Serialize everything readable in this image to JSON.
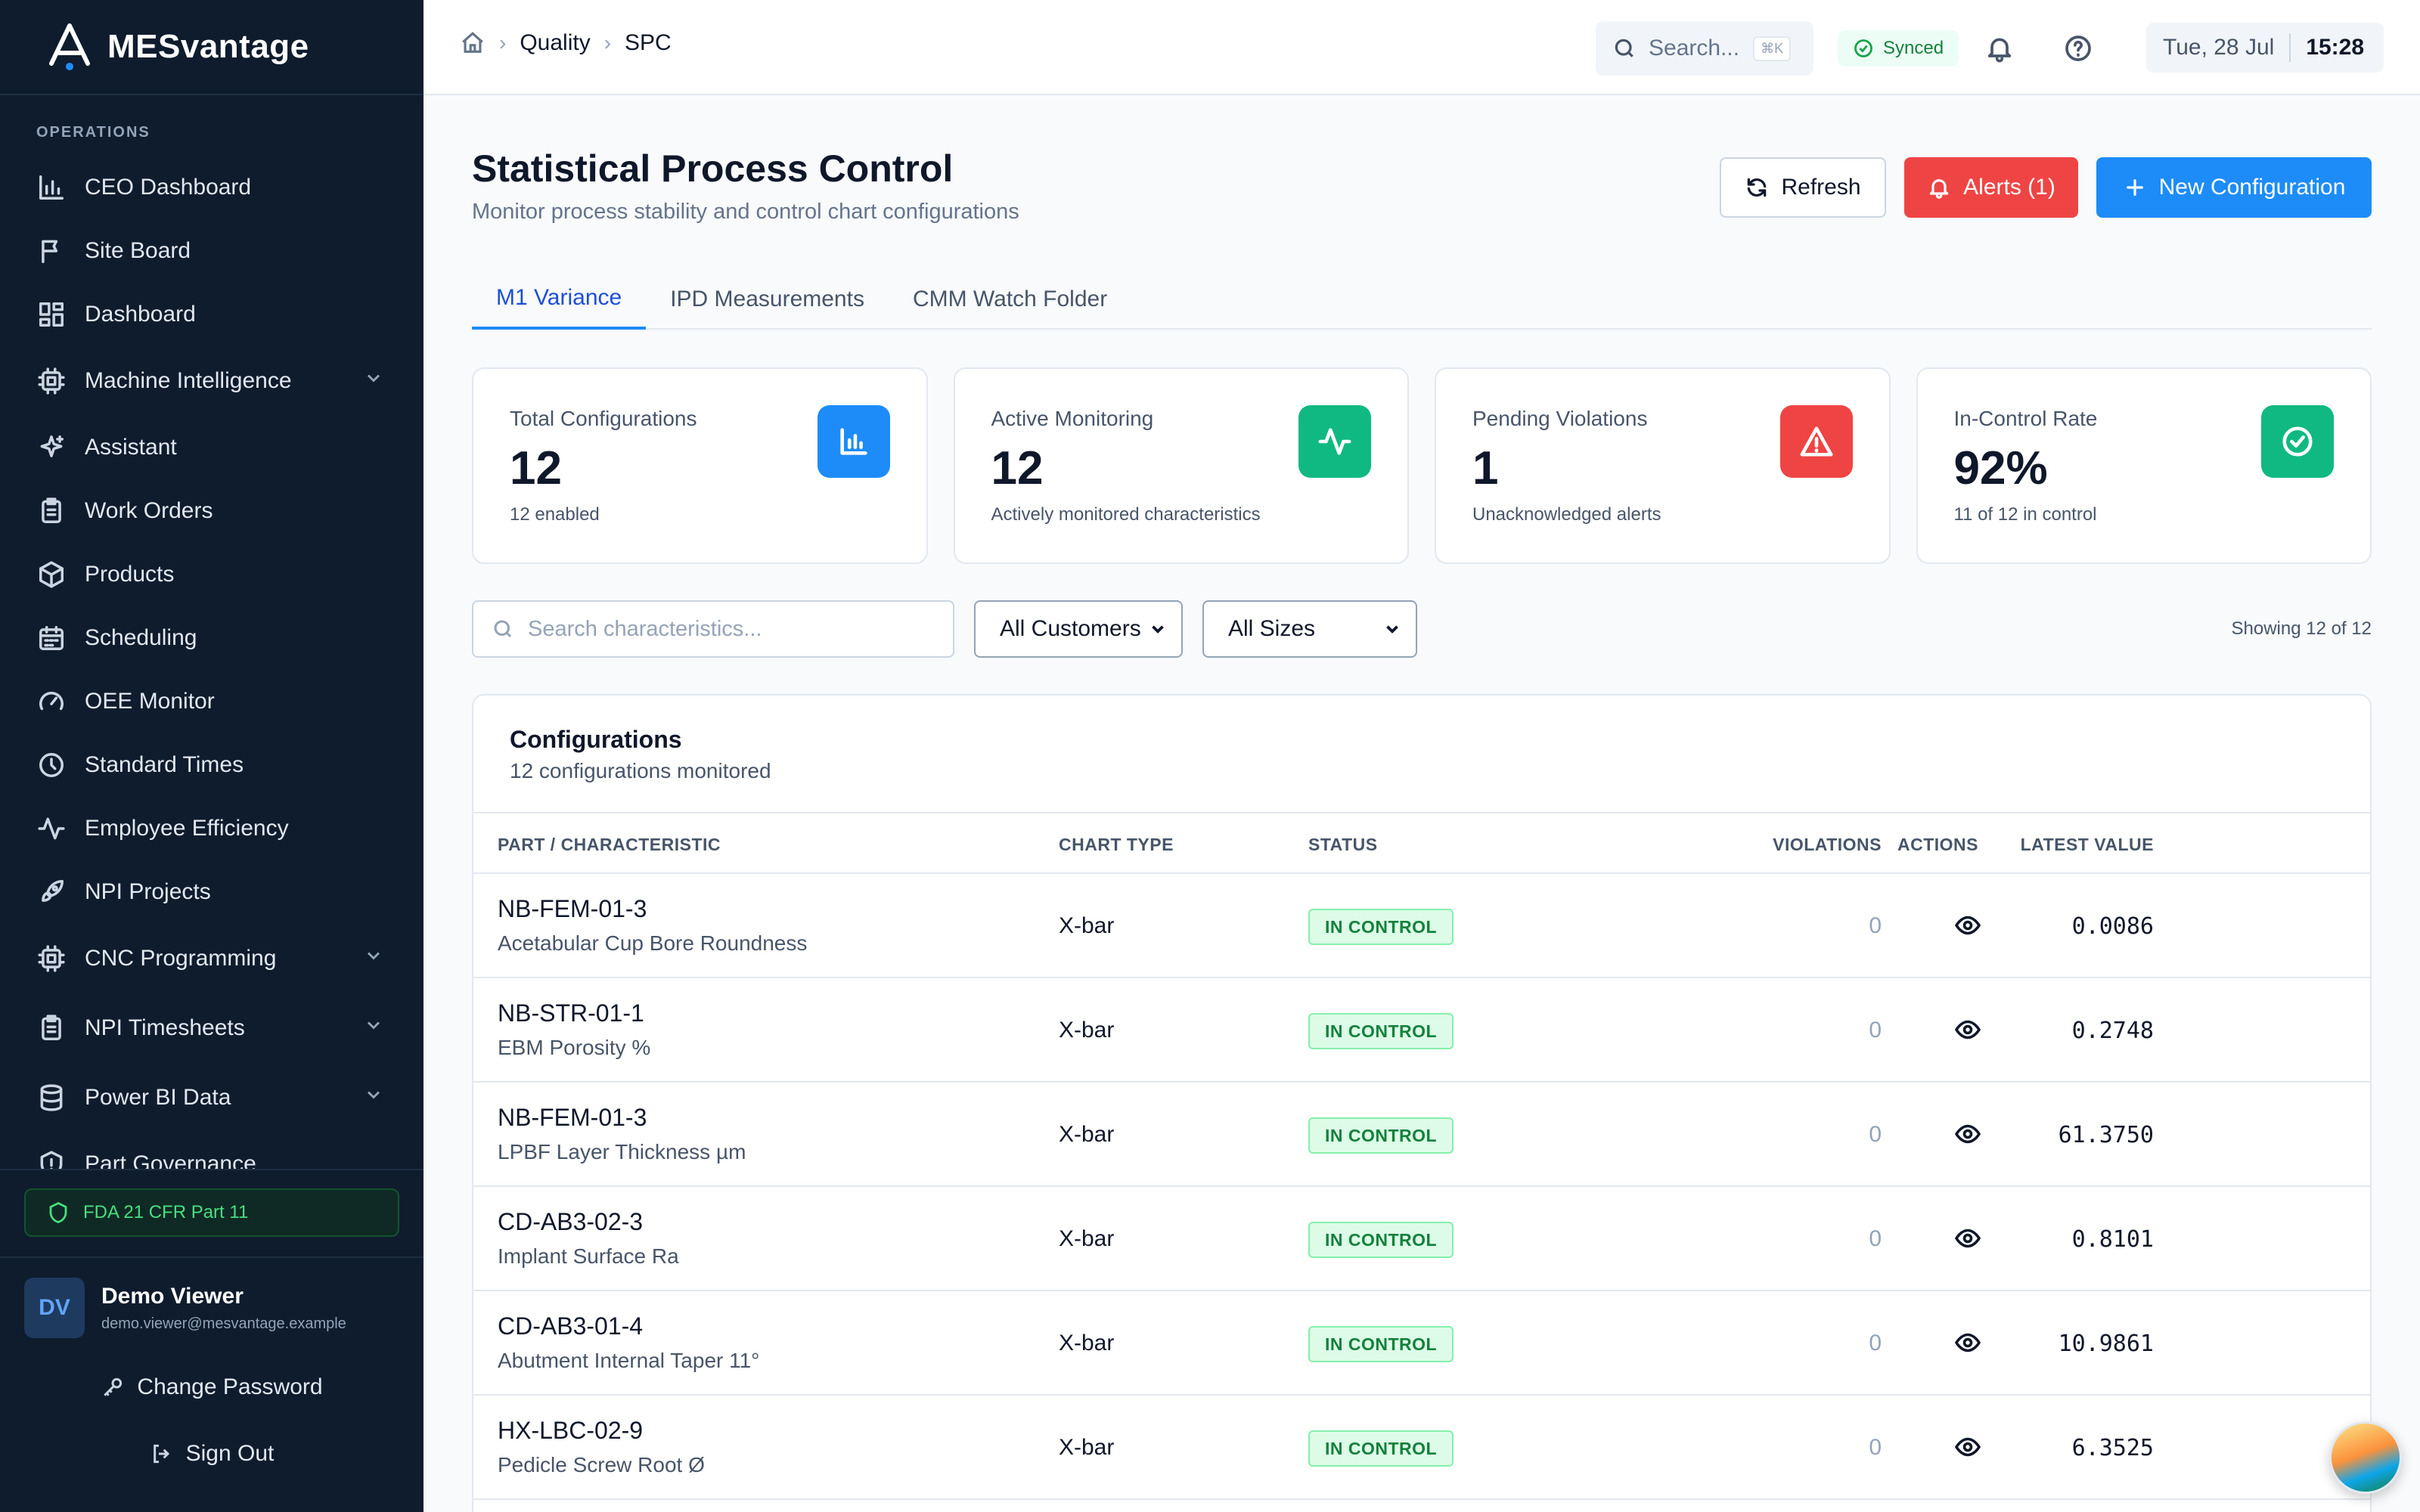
{
  "brand": {
    "name": "MESvantage"
  },
  "sidebar": {
    "section": "OPERATIONS",
    "items": [
      {
        "label": "CEO Dashboard",
        "icon": "bar-chart-icon",
        "chevron": false
      },
      {
        "label": "Site Board",
        "icon": "flag-icon",
        "chevron": false
      },
      {
        "label": "Dashboard",
        "icon": "grid-icon",
        "chevron": false
      },
      {
        "label": "Machine Intelligence",
        "icon": "cpu-icon",
        "chevron": true
      },
      {
        "label": "Assistant",
        "icon": "sparkles-icon",
        "chevron": false
      },
      {
        "label": "Work Orders",
        "icon": "clipboard-icon",
        "chevron": false
      },
      {
        "label": "Products",
        "icon": "package-icon",
        "chevron": false
      },
      {
        "label": "Scheduling",
        "icon": "calendar-icon",
        "chevron": false
      },
      {
        "label": "OEE Monitor",
        "icon": "gauge-icon",
        "chevron": false
      },
      {
        "label": "Standard Times",
        "icon": "clock-icon",
        "chevron": false
      },
      {
        "label": "Employee Efficiency",
        "icon": "activity-icon",
        "chevron": false
      },
      {
        "label": "NPI Projects",
        "icon": "rocket-icon",
        "chevron": false
      },
      {
        "label": "CNC Programming",
        "icon": "cpu-icon",
        "chevron": true
      },
      {
        "label": "NPI Timesheets",
        "icon": "clipboard-icon",
        "chevron": true
      },
      {
        "label": "Power BI Data",
        "icon": "database-icon",
        "chevron": true
      },
      {
        "label": "Part Governance",
        "icon": "shield-alert-icon",
        "chevron": false
      }
    ],
    "compliance": "FDA 21 CFR Part 11",
    "user": {
      "initials": "DV",
      "name": "Demo Viewer",
      "email": "demo.viewer@mesvantage.example"
    },
    "change_password": "Change Password",
    "sign_out": "Sign Out"
  },
  "topbar": {
    "breadcrumb": [
      "Quality",
      "SPC"
    ],
    "search_placeholder": "Search...",
    "search_shortcut": "⌘K",
    "sync_status": "Synced",
    "date": "Tue, 28 Jul",
    "time": "15:28"
  },
  "page": {
    "title": "Statistical Process Control",
    "subtitle": "Monitor process stability and control chart configurations",
    "buttons": {
      "refresh": "Refresh",
      "alerts": "Alerts (1)",
      "new": "New Configuration"
    },
    "tabs": [
      "M1 Variance",
      "IPD Measurements",
      "CMM Watch Folder"
    ],
    "active_tab": 0
  },
  "stats": [
    {
      "label": "Total Configurations",
      "value": "12",
      "sub": "12 enabled",
      "icon": "bar-chart-icon",
      "color": "#1d8cf8"
    },
    {
      "label": "Active Monitoring",
      "value": "12",
      "sub": "Actively monitored characteristics",
      "icon": "activity-icon",
      "color": "#10b981"
    },
    {
      "label": "Pending Violations",
      "value": "1",
      "sub": "Unacknowledged alerts",
      "icon": "alert-triangle-icon",
      "color": "#ef4444"
    },
    {
      "label": "In-Control Rate",
      "value": "92%",
      "sub": "11 of 12 in control",
      "icon": "check-circle-icon",
      "color": "#10b981"
    }
  ],
  "filters": {
    "search_placeholder": "Search characteristics...",
    "customer": "All Customers",
    "size": "All Sizes",
    "showing": "Showing 12 of 12"
  },
  "table": {
    "title": "Configurations",
    "subtitle": "12 configurations monitored",
    "columns": [
      "PART / CHARACTERISTIC",
      "CHART TYPE",
      "STATUS",
      "VIOLATIONS",
      "LATEST VALUE",
      "ACTIONS"
    ],
    "rows": [
      {
        "part": "NB-FEM-01-3",
        "characteristic": "Acetabular Cup Bore Roundness",
        "chart_type": "X-bar",
        "status": "IN CONTROL",
        "violations": "0",
        "latest": "0.0086"
      },
      {
        "part": "NB-STR-01-1",
        "characteristic": "EBM Porosity %",
        "chart_type": "X-bar",
        "status": "IN CONTROL",
        "violations": "0",
        "latest": "0.2748"
      },
      {
        "part": "NB-FEM-01-3",
        "characteristic": "LPBF Layer Thickness µm",
        "chart_type": "X-bar",
        "status": "IN CONTROL",
        "violations": "0",
        "latest": "61.3750"
      },
      {
        "part": "CD-AB3-02-3",
        "characteristic": "Implant Surface Ra",
        "chart_type": "X-bar",
        "status": "IN CONTROL",
        "violations": "0",
        "latest": "0.8101"
      },
      {
        "part": "CD-AB3-01-4",
        "characteristic": "Abutment Internal Taper 11°",
        "chart_type": "X-bar",
        "status": "IN CONTROL",
        "violations": "0",
        "latest": "10.9861"
      },
      {
        "part": "HX-LBC-02-9",
        "characteristic": "Pedicle Screw Root Ø",
        "chart_type": "X-bar",
        "status": "IN CONTROL",
        "violations": "0",
        "latest": "6.3525"
      }
    ]
  }
}
